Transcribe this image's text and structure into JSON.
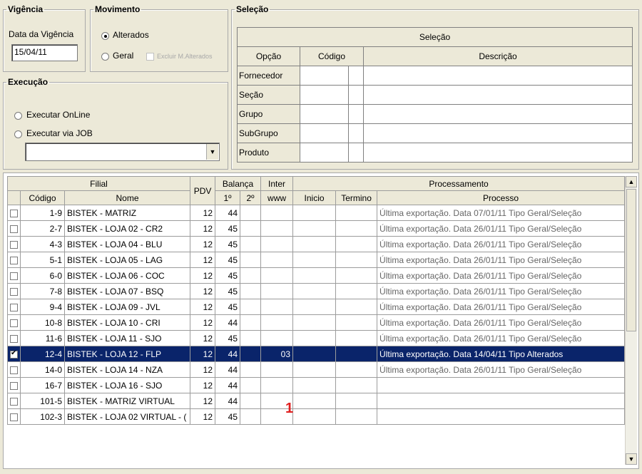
{
  "vigencia": {
    "legend": "Vigência",
    "label": "Data da Vigência",
    "value": "15/04/11"
  },
  "movimento": {
    "legend": "Movimento",
    "alterados": "Alterados",
    "geral": "Geral",
    "excluir": "Excluir M.Alterados"
  },
  "execucao": {
    "legend": "Execução",
    "online": "Executar OnLine",
    "job": "Executar via JOB",
    "combo_value": ""
  },
  "selecao": {
    "legend": "Seleção",
    "header": "Seleção",
    "columns": {
      "opcao": "Opção",
      "codigo": "Código",
      "descricao": "Descrição"
    },
    "rows": [
      "Fornecedor",
      "Seção",
      "Grupo",
      "SubGrupo",
      "Produto"
    ]
  },
  "grid": {
    "headers": {
      "filial": "Filial",
      "codigo": "Código",
      "nome": "Nome",
      "pdv": "PDV",
      "balanca": "Balança",
      "b1": "1º",
      "b2": "2º",
      "inter": "Inter",
      "www": "www",
      "processamento": "Processamento",
      "inicio": "Inicio",
      "termino": "Termino",
      "processo": "Processo"
    },
    "rows": [
      {
        "checked": false,
        "codigo": "1-9",
        "nome": "BISTEK - MATRIZ",
        "pdv": "12",
        "b1": "44",
        "b2": "",
        "www": "",
        "inicio": "",
        "termino": "",
        "processo": "Última exportação. Data 07/01/11 Tipo Geral/Seleção"
      },
      {
        "checked": false,
        "codigo": "2-7",
        "nome": "BISTEK - LOJA 02 - CR2",
        "pdv": "12",
        "b1": "45",
        "b2": "",
        "www": "",
        "inicio": "",
        "termino": "",
        "processo": "Última exportação. Data 26/01/11 Tipo Geral/Seleção"
      },
      {
        "checked": false,
        "codigo": "4-3",
        "nome": "BISTEK - LOJA 04 -  BLU",
        "pdv": "12",
        "b1": "45",
        "b2": "",
        "www": "",
        "inicio": "",
        "termino": "",
        "processo": "Última exportação. Data 26/01/11 Tipo Geral/Seleção"
      },
      {
        "checked": false,
        "codigo": "5-1",
        "nome": "BISTEK - LOJA 05 - LAG",
        "pdv": "12",
        "b1": "45",
        "b2": "",
        "www": "",
        "inicio": "",
        "termino": "",
        "processo": "Última exportação. Data 26/01/11 Tipo Geral/Seleção"
      },
      {
        "checked": false,
        "codigo": "6-0",
        "nome": "BISTEK - LOJA 06 - COC",
        "pdv": "12",
        "b1": "45",
        "b2": "",
        "www": "",
        "inicio": "",
        "termino": "",
        "processo": "Última exportação. Data 26/01/11 Tipo Geral/Seleção"
      },
      {
        "checked": false,
        "codigo": "7-8",
        "nome": "BISTEK - LOJA 07 - BSQ",
        "pdv": "12",
        "b1": "45",
        "b2": "",
        "www": "",
        "inicio": "",
        "termino": "",
        "processo": "Última exportação. Data 26/01/11 Tipo Geral/Seleção"
      },
      {
        "checked": false,
        "codigo": "9-4",
        "nome": "BISTEK - LOJA 09 - JVL",
        "pdv": "12",
        "b1": "45",
        "b2": "",
        "www": "",
        "inicio": "",
        "termino": "",
        "processo": "Última exportação. Data 26/01/11 Tipo Geral/Seleção"
      },
      {
        "checked": false,
        "codigo": "10-8",
        "nome": "BISTEK - LOJA 10 - CRI",
        "pdv": "12",
        "b1": "44",
        "b2": "",
        "www": "",
        "inicio": "",
        "termino": "",
        "processo": "Última exportação. Data 26/01/11 Tipo Geral/Seleção"
      },
      {
        "checked": false,
        "codigo": "11-6",
        "nome": "BISTEK - LOJA 11 - SJO",
        "pdv": "12",
        "b1": "45",
        "b2": "",
        "www": "",
        "inicio": "",
        "termino": "",
        "processo": "Última exportação. Data 26/01/11 Tipo Geral/Seleção"
      },
      {
        "checked": true,
        "selected": true,
        "codigo": "12-4",
        "nome": "BISTEK - LOJA 12 - FLP",
        "pdv": "12",
        "b1": "44",
        "b2": "",
        "www": "03",
        "inicio": "",
        "termino": "",
        "processo": "Última exportação. Data 14/04/11 Tipo Alterados"
      },
      {
        "checked": false,
        "codigo": "14-0",
        "nome": "BISTEK - LOJA 14 - NZA",
        "pdv": "12",
        "b1": "44",
        "b2": "",
        "www": "",
        "inicio": "",
        "termino": "",
        "processo": "Última exportação. Data 26/01/11 Tipo Geral/Seleção"
      },
      {
        "checked": false,
        "codigo": "16-7",
        "nome": "BISTEK - LOJA 16 - SJO",
        "pdv": "12",
        "b1": "44",
        "b2": "",
        "www": "",
        "inicio": "",
        "termino": "",
        "processo": ""
      },
      {
        "checked": false,
        "codigo": "101-5",
        "nome": "BISTEK - MATRIZ VIRTUAL",
        "pdv": "12",
        "b1": "44",
        "b2": "",
        "www": "",
        "inicio": "",
        "termino": "",
        "processo": ""
      },
      {
        "checked": false,
        "codigo": "102-3",
        "nome": "BISTEK - LOJA 02 VIRTUAL - (",
        "pdv": "12",
        "b1": "45",
        "b2": "",
        "www": "",
        "inicio": "",
        "termino": "",
        "processo": ""
      }
    ]
  },
  "annotation": {
    "marker": "1",
    "color": "#e02020"
  },
  "colors": {
    "selected_row": "#0a246a",
    "window_bg": "#ece9d8"
  }
}
